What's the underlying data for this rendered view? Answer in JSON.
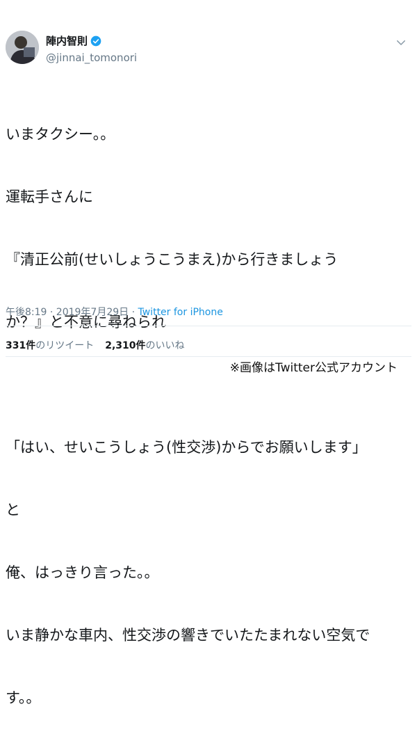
{
  "user": {
    "display_name": "陣内智則",
    "handle": "@jinnai_tomonori"
  },
  "icons": {
    "avatar": "avatar-photo",
    "verified": "verified-badge-icon",
    "menu": "chevron-down-icon"
  },
  "colors": {
    "accent": "#1b95e0",
    "text": "#14171a",
    "muted": "#657786"
  },
  "tweet": {
    "lines": [
      "いまタクシー。。",
      "運転手さんに",
      "『清正公前(せいしょうこうまえ)から行きましょう",
      "か？』と不意に尋ねられ",
      "",
      "「はい、せいこうしょう(性交渉)からでお願いします」",
      "と",
      "俺、はっきり言った。。",
      "いま静かな車内、性交渉の響きでいたたまれない空気で",
      "す。。"
    ]
  },
  "meta": {
    "timestamp": "午後8:19 · 2019年7月29日",
    "separator": " · ",
    "source": "Twitter for iPhone"
  },
  "stats": {
    "retweets_count": "331件",
    "retweets_label": "のリツイート",
    "likes_count": "2,310件",
    "likes_label": "のいいね"
  },
  "credit": "※画像はTwitter公式アカウント"
}
